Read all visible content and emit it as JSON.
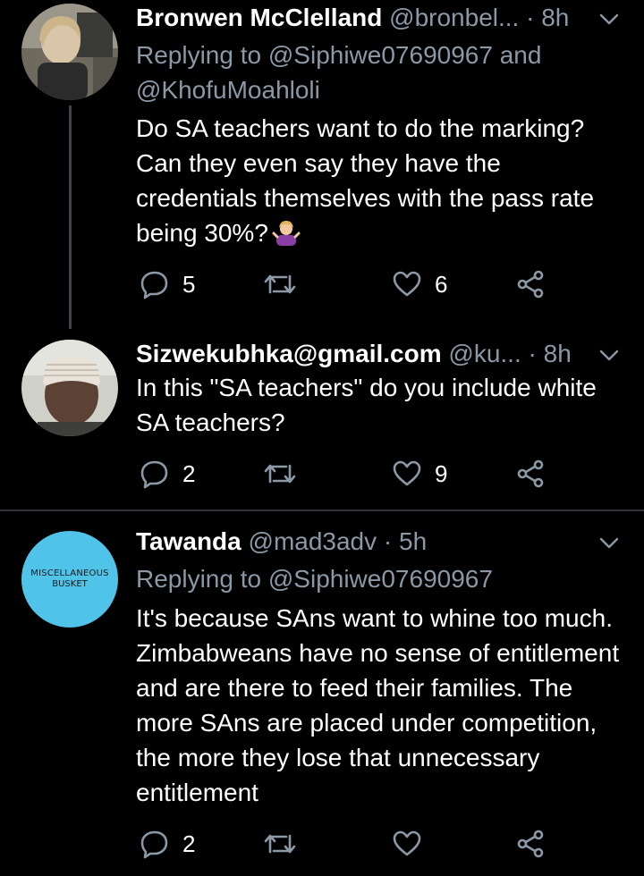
{
  "tweets": [
    {
      "name": "Bronwen McClelland",
      "handle": "@bronbel...",
      "separator": "·",
      "time": "8h",
      "reply_prefix": "Replying to",
      "reply_mention_1": "@Siphiwe07690967",
      "reply_joiner": "and",
      "reply_mention_2": "@KhofuMoahloli",
      "text": "Do SA teachers want to do the marking? Can they even say they have the credentials themselves with the pass rate being 30%?",
      "emoji": "person-shrugging-icon",
      "replies": "5",
      "retweets": "",
      "likes": "6"
    },
    {
      "name": "Sizwekubhka@gmail.com",
      "handle": "@ku...",
      "separator": "·",
      "time": "8h",
      "text": "In this \"SA teachers\" do you include white SA teachers?",
      "replies": "2",
      "retweets": "",
      "likes": "9"
    },
    {
      "name": "Tawanda",
      "handle": "@mad3adv",
      "separator": "·",
      "time": "5h",
      "avatar_text_line1": "MISCELLANEOUS",
      "avatar_text_line2": "BUSKET",
      "reply_prefix": "Replying to",
      "reply_mention_1": "@Siphiwe07690967",
      "text": "It's because SAns want to whine too much. Zimbabweans have no sense of entitlement and are there to feed their families. The more SAns are placed under competition, the more they lose that unnecessary  entitlement",
      "replies": "2",
      "retweets": "",
      "likes": ""
    }
  ],
  "colors": {
    "background": "#000000",
    "text": "#ffffff",
    "secondary": "#8b98a5",
    "divider": "#2f3336",
    "avatar3_bg": "#4fc3e8"
  }
}
